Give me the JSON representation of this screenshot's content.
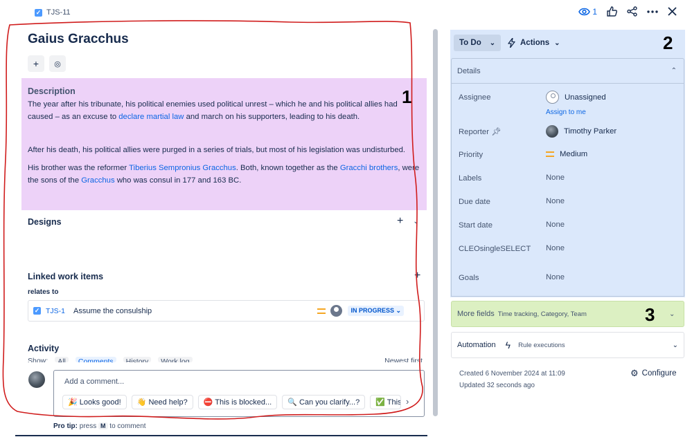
{
  "header": {
    "issue_key": "TJS-11",
    "watch_count": "1"
  },
  "issue": {
    "title": "Gaius Gracchus",
    "description": {
      "heading": "Description",
      "p1_part1": "The year after his tribunate, his political enemies used political unrest – which he and his political allies had caused – as an excuse to ",
      "p1_link": "declare martial law",
      "p1_part2": " and march on his supporters, leading to his death.",
      "p2": "After his death, his political allies were purged in a series of trials, but most of his legislation was undisturbed.",
      "p3_part1": "His brother was the reformer ",
      "p3_link1": "Tiberius Sempronius Gracchus",
      "p3_part2": ". Both, known together as the ",
      "p3_link2": "Gracchi brothers",
      "p3_part3": ", were the sons of the ",
      "p3_link3": "Gracchus",
      "p3_part4": " who was consul in 177 and 163 BC."
    },
    "designs_title": "Designs",
    "linked": {
      "title": "Linked work items",
      "relation": "relates to",
      "items": [
        {
          "key": "TJS-1",
          "summary": "Assume the consulship",
          "status": "IN PROGRESS"
        }
      ]
    },
    "activity": {
      "title": "Activity",
      "show_label": "Show:",
      "tabs": [
        "All",
        "Comments",
        "History",
        "Work log"
      ],
      "sort_label": "Newest first"
    },
    "comment": {
      "placeholder": "Add a comment...",
      "chips": [
        "🎉 Looks good!",
        "👋 Need help?",
        "⛔ This is blocked...",
        "🔍 Can you clarify...?",
        "✅ This"
      ],
      "protip_prefix": "Pro tip:",
      "protip_press": "press",
      "protip_key": "M",
      "protip_suffix": "to comment"
    }
  },
  "annotations": {
    "one": "1",
    "two": "2",
    "three": "3"
  },
  "sidebar": {
    "status": "To Do",
    "actions_label": "Actions",
    "details_title": "Details",
    "fields": {
      "assignee_label": "Assignee",
      "assignee_value": "Unassigned",
      "assign_to_me": "Assign to me",
      "reporter_label": "Reporter",
      "reporter_value": "Timothy Parker",
      "priority_label": "Priority",
      "priority_value": "Medium",
      "labels_label": "Labels",
      "labels_value": "None",
      "due_label": "Due date",
      "due_value": "None",
      "start_label": "Start date",
      "start_value": "None",
      "cleo_label": "CLEOsingleSELECT",
      "cleo_value": "None",
      "goals_label": "Goals",
      "goals_value": "None"
    },
    "more_fields": {
      "title": "More fields",
      "subtitle": "Time tracking, Category, Team"
    },
    "automation": {
      "title": "Automation",
      "rules": "Rule executions"
    },
    "meta": {
      "created": "Created 6 November 2024 at 11:09",
      "updated": "Updated 32 seconds ago",
      "configure": "Configure"
    }
  },
  "colors": {
    "description_highlight": "#edd2f8",
    "sidebar_highlight": "#dbe8fb",
    "more_fields_highlight": "#dcf0c2",
    "link": "#0c66e4",
    "annotation_outline": "#d01c1c"
  }
}
